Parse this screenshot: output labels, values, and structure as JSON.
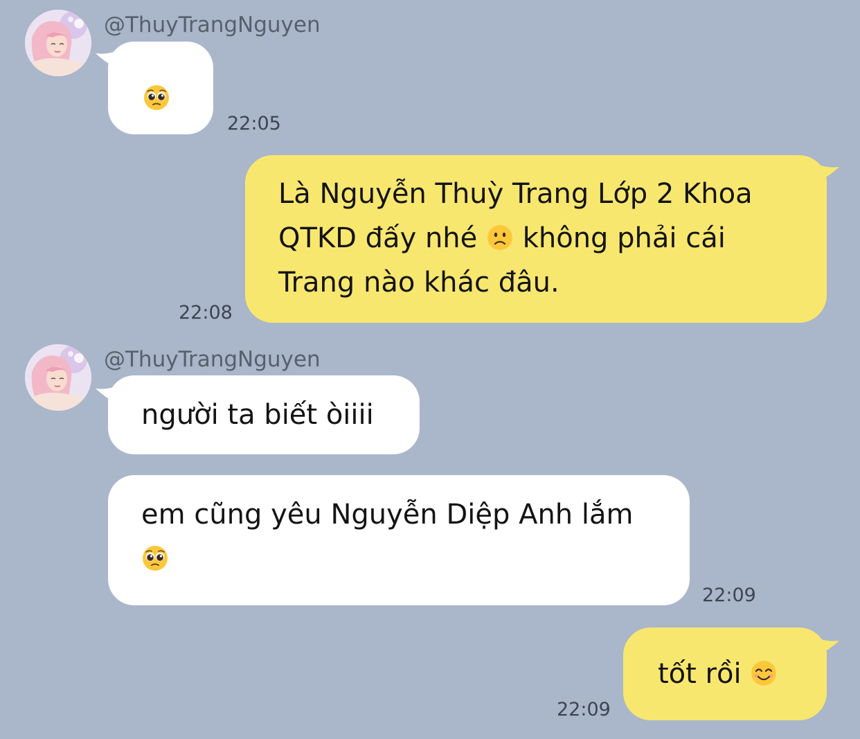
{
  "chat": {
    "contact_handle": "@ThuyTrangNguyen",
    "messages": [
      {
        "direction": "incoming",
        "emoji": "pleading-face",
        "time": "22:05"
      },
      {
        "direction": "outgoing",
        "line1": "Là Nguyễn Thuỳ Trang Lớp 2 Khoa",
        "line2_before": "QTKD đấy nhé ",
        "line2_emoji": "slightly-frowning-face",
        "line2_after": " không phải cái",
        "line3": "Trang nào khác đâu.",
        "time": "22:08"
      },
      {
        "direction": "incoming",
        "text": "người ta biết òiiii"
      },
      {
        "direction": "incoming",
        "line1": "em cũng yêu Nguyễn Diệp Anh lắm",
        "line2_emoji": "pleading-face",
        "time": "22:09"
      },
      {
        "direction": "outgoing",
        "text": "tốt rồi ",
        "emoji": "smiling-face-with-smiling-eyes",
        "time": "22:09"
      }
    ]
  },
  "colors": {
    "background": "#aab6c9",
    "incoming_bubble": "#ffffff",
    "outgoing_bubble": "#f8e76f"
  }
}
